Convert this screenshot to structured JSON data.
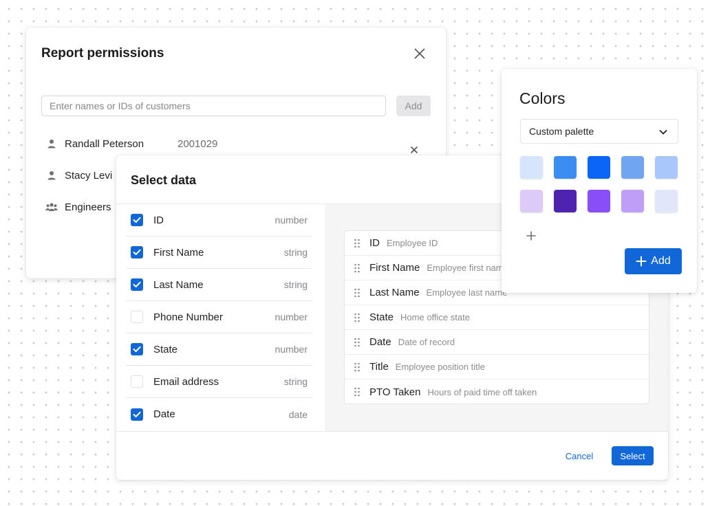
{
  "permissions": {
    "title": "Report permissions",
    "search_placeholder": "Enter names or IDs of customers",
    "add_label": "Add",
    "entries": [
      {
        "name": "Randall Peterson",
        "id": "2001029",
        "icon": "user-icon"
      },
      {
        "name": "Stacy Levi",
        "icon": "user-icon"
      },
      {
        "name": "Engineers",
        "icon": "group-icon"
      }
    ]
  },
  "select_data": {
    "title": "Select data",
    "fields": [
      {
        "name": "ID",
        "type": "number",
        "checked": true
      },
      {
        "name": "First Name",
        "type": "string",
        "checked": true
      },
      {
        "name": "Last Name",
        "type": "string",
        "checked": true
      },
      {
        "name": "Phone Number",
        "type": "number",
        "checked": false
      },
      {
        "name": "State",
        "type": "number",
        "checked": true
      },
      {
        "name": "Email address",
        "type": "string",
        "checked": false
      },
      {
        "name": "Date",
        "type": "date",
        "checked": true
      }
    ],
    "columns": [
      {
        "name": "ID",
        "desc": "Employee ID"
      },
      {
        "name": "First Name",
        "desc": "Employee first name"
      },
      {
        "name": "Last Name",
        "desc": "Employee last name"
      },
      {
        "name": "State",
        "desc": "Home office state"
      },
      {
        "name": "Date",
        "desc": "Date of record"
      },
      {
        "name": "Title",
        "desc": "Employee position title"
      },
      {
        "name": "PTO Taken",
        "desc": "Hours of paid time off taken"
      }
    ],
    "cancel_label": "Cancel",
    "select_label": "Select"
  },
  "colors": {
    "title": "Colors",
    "palette_value": "Custom palette",
    "swatches": [
      [
        "#d6e4fc",
        "#3c8df3",
        "#0b66f8",
        "#70a6f1",
        "#a9c7fb"
      ],
      [
        "#dccbf6",
        "#4e23b0",
        "#8a4ef9",
        "#be9ef6",
        "#e1e6fb"
      ]
    ],
    "add_label": "Add"
  },
  "theme": {
    "accent": "#1167d8"
  }
}
